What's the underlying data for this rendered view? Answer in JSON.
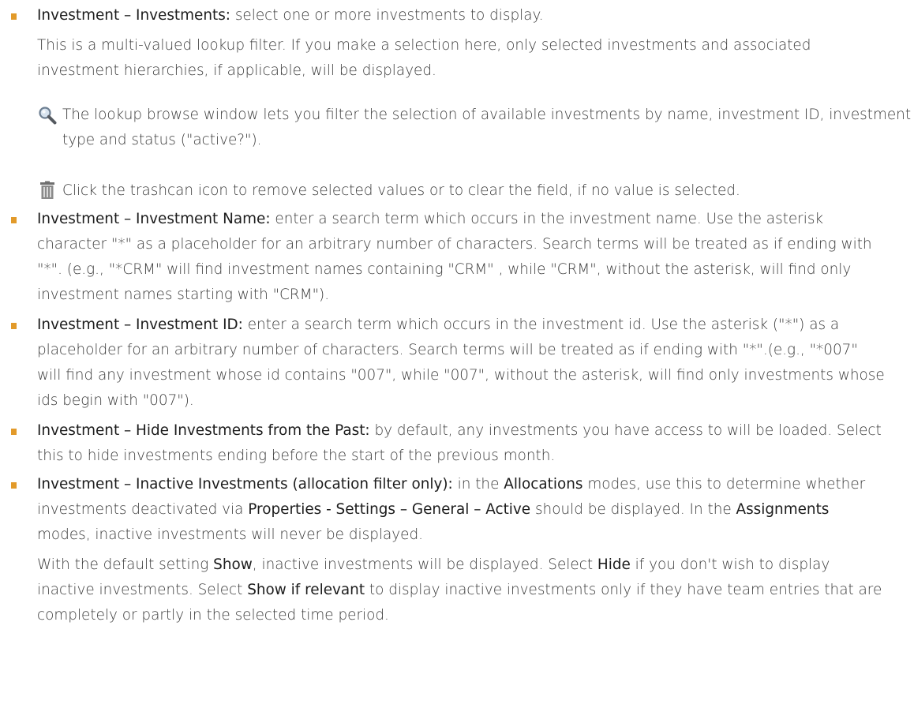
{
  "colors": {
    "bullet": "#e29a2a",
    "text": "#3b3b3b",
    "strong": "#1c1c1c"
  },
  "items": [
    {
      "term": "Investment – Investments:",
      "text": " select one or more investments to display.",
      "para": "This is a multi-valued lookup filter. If you make a selection here, only selected investments and associated investment hierarchies, if applicable, will be displayed.",
      "lookup_note": "The lookup browse window lets you filter the selection of available investments by name, investment ID, investment type and status (\"active?\").",
      "trash_note": "Click the trashcan icon to remove selected values or to clear the field, if no value is selected."
    },
    {
      "term": "Investment – Investment Name:",
      "text": " enter a search term which occurs in the investment name. Use the asterisk character \"*\" as a placeholder for an arbitrary number of characters. Search terms will be treated as if ending with \"*\". (e.g., \"*CRM\" will find investment names containing \"CRM\" , while \"CRM\", without the asterisk, will find only investment names starting with \"CRM\")."
    },
    {
      "term": "Investment – Investment ID:",
      "text": " enter a search term which occurs in the investment id. Use the asterisk (\"*\") as a placeholder for an arbitrary number of characters. Search terms will be treated as if ending with \"*\".(e.g., \"*007\" will find any investment whose id contains \"007\", while \"007\", without the asterisk, will find only investments whose ids begin with \"007\")."
    },
    {
      "term": "Investment – Hide Investments from the Past:",
      "text": " by default, any investments you have access to will be loaded. Select this to hide investments ending before the start of the previous month."
    },
    {
      "term": "Investment – Inactive Investments (allocation filter only):",
      "t1": " in the ",
      "ui1": "Allocations",
      "t2": " modes, use this to determine whether investments deactivated via ",
      "ui2": "Properties - Settings – General – Active",
      "t3": " should be displayed. In the ",
      "ui3": "Assignments",
      "t4": " modes, inactive investments will never be displayed.",
      "p1": "With the default setting ",
      "p_ui1": "Show",
      "p2": ", inactive investments will be displayed. Select ",
      "p_ui2": "Hide",
      "p3": " if you don't wish to display inactive investments. Select ",
      "p_ui3": "Show if relevant",
      "p4": " to display inactive investments only if they have team entries that are completely or partly in the selected time period."
    }
  ]
}
